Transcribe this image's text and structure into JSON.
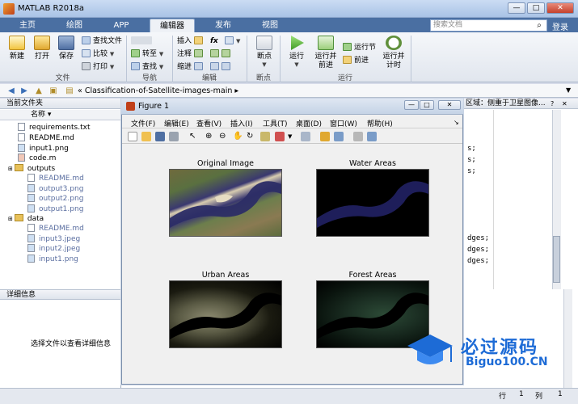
{
  "app": {
    "title": "MATLAB R2018a",
    "min": "—",
    "max": "□",
    "close": "✕"
  },
  "tabs": [
    "主页",
    "绘图",
    "APP",
    "编辑器",
    "发布",
    "视图"
  ],
  "search": {
    "placeholder": "搜索文档",
    "login": "登录"
  },
  "ribbon": {
    "file": {
      "new": "新建",
      "open": "打开",
      "save": "保存",
      "find_files": "查找文件",
      "compare": "比较",
      "print": "打印",
      "group": "文件"
    },
    "navigate": {
      "goto": "转至",
      "find": "查找",
      "group": "导航"
    },
    "edit": {
      "insert": "插入",
      "fx": "fx",
      "comment": "注释",
      "indent": "缩进",
      "group": "编辑"
    },
    "breakpoints": {
      "breakpoints": "断点",
      "group": "断点"
    },
    "run": {
      "run": "运行",
      "run_advance": "运行并\n前进",
      "run_section": "运行节",
      "advance": "前进",
      "run_time": "运行并\n计时",
      "group": "运行"
    }
  },
  "pathbar": {
    "path": "« Classification-of-Satellite-images-main ▸"
  },
  "current_folder": {
    "header": "当前文件夹",
    "name_col": "名称 ▾",
    "items": [
      "requirements.txt",
      "README.md",
      "input1.png",
      "code.m",
      "outputs",
      "README.md",
      "output3.png",
      "output2.png",
      "output1.png",
      "data",
      "README.md",
      "input3.jpeg",
      "input2.jpeg",
      "input1.png"
    ]
  },
  "details": {
    "header": "详细信息",
    "message": "选择文件以查看详细信息"
  },
  "editor": {
    "tab_text": "区域：侧重于卫星图像...",
    "code": [
      "s;",
      "s;",
      "s;",
      "dges;",
      "dges;",
      "dges;"
    ]
  },
  "figure": {
    "title": "Figure 1",
    "menus": [
      "文件(F)",
      "编辑(E)",
      "查看(V)",
      "插入(I)",
      "工具(T)",
      "桌面(D)",
      "窗口(W)",
      "帮助(H)"
    ],
    "plots": [
      "Original Image",
      "Water Areas",
      "Urban Areas",
      "Forest Areas"
    ]
  },
  "status": {
    "row_label": "行",
    "row": "1",
    "col_label": "列",
    "col": "1"
  },
  "watermark": {
    "text_cn": "必过源码",
    "text_en": "Biguo100.CN"
  }
}
